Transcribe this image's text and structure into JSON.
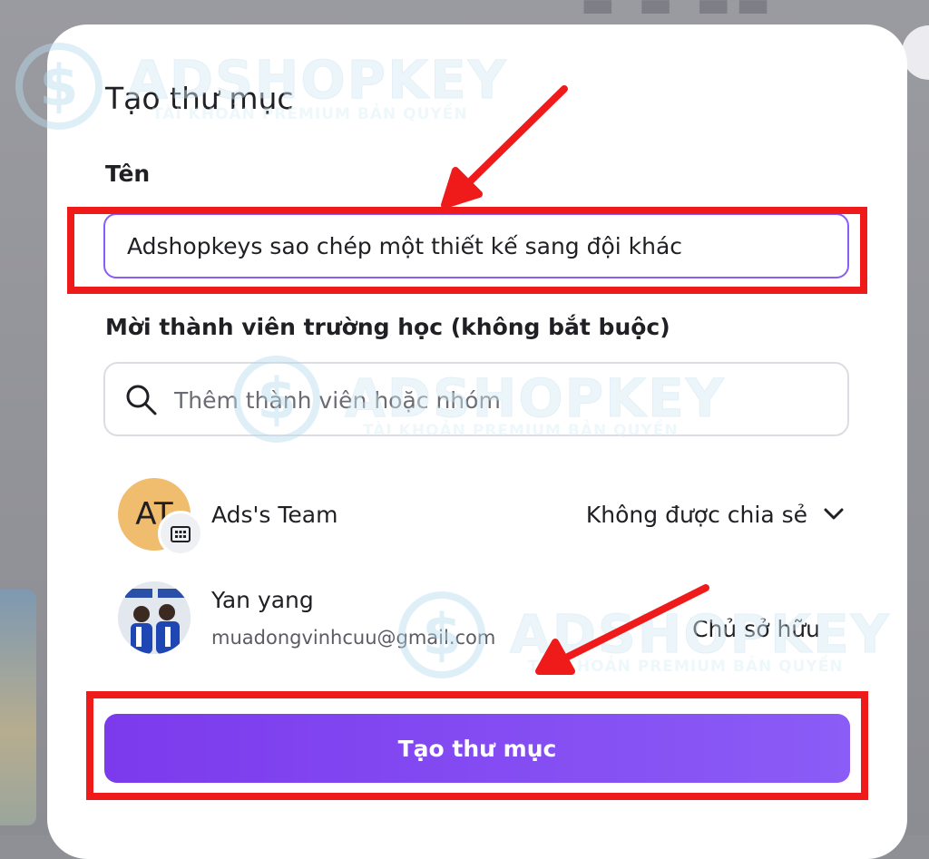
{
  "dialog": {
    "title": "Tạo thư mục",
    "name_label": "Tên",
    "name_value": "Adshopkeys sao chép một thiết kế sang đội khác",
    "invite_label": "Mời thành viên trường học (không bắt buộc)",
    "search_placeholder": "Thêm thành viên hoặc nhóm",
    "members": [
      {
        "initials": "AT",
        "name": "Ads's Team",
        "role": "Không được chia sẻ"
      },
      {
        "name": "Yan yang",
        "email": "muadongvinhcuu@gmail.com",
        "role": "Chủ sở hữu"
      }
    ],
    "create_button": "Tạo thư mục"
  },
  "watermark": {
    "brand": "ADSHOPKEY",
    "tagline": "TÀI KHOẢN PREMIUM BẢN QUYỀN"
  },
  "colors": {
    "accent": "#8b5cf6",
    "highlight": "#ef1b1b",
    "avatar_team": "#f0bd6f"
  },
  "icons": [
    "search-icon",
    "group-badge-icon",
    "chevron-down-icon",
    "dollar-logo-icon"
  ]
}
